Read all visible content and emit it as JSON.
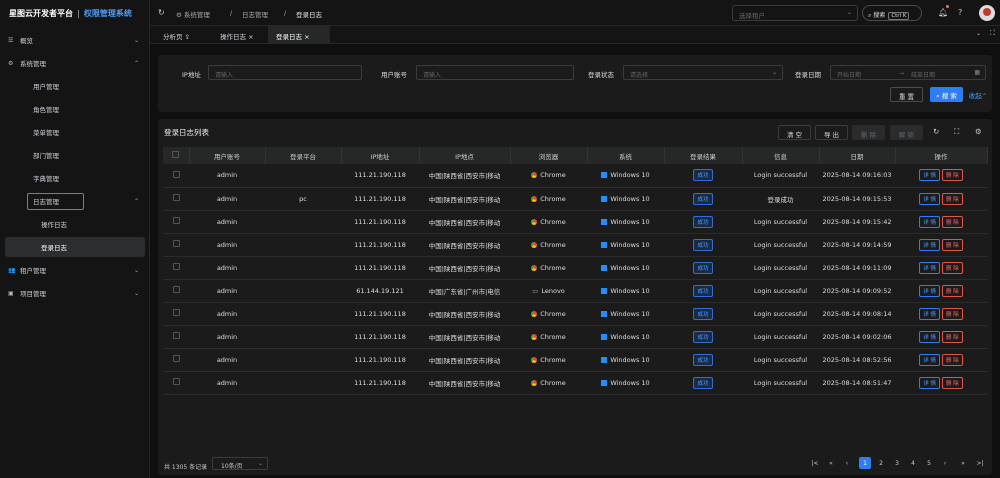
{
  "brand": {
    "name": "星图云开发者平台",
    "sep": "|",
    "sub": "权限管理系统"
  },
  "sidebar": {
    "overview": "概览",
    "system": "系统管理",
    "user": "用户管理",
    "role": "角色管理",
    "menu": "菜单管理",
    "dept": "部门管理",
    "dict": "字典管理",
    "log": "日志管理",
    "oplog": "操作日志",
    "loginlog": "登录日志",
    "tenant": "租户管理",
    "project": "项目管理"
  },
  "header": {
    "bc1": "系统管理",
    "bc2": "日志管理",
    "bc3": "登录日志",
    "tenant_placeholder": "选择租户",
    "search": "搜索",
    "kbd": "Ctrl K"
  },
  "tabs": [
    "分析页",
    "操作日志",
    "登录日志"
  ],
  "filter": {
    "ip_label": "IP地址",
    "ip_ph": "请输入",
    "user_label": "用户账号",
    "user_ph": "请输入",
    "status_label": "登录状态",
    "status_ph": "请选择",
    "date_label": "登录日期",
    "start_ph": "开始日期",
    "arrow": "→",
    "end_ph": "结束日期",
    "reset": "重 置",
    "search": "搜 索",
    "collapse": "收起"
  },
  "table": {
    "title": "登录日志列表",
    "buttons": {
      "clear": "清 空",
      "export": "导 出",
      "delete": "删 除",
      "unlock": "解 锁"
    },
    "columns": [
      "用户账号",
      "登录平台",
      "IP地址",
      "IP地点",
      "浏览器",
      "系统",
      "登录结果",
      "信息",
      "日期",
      "操作"
    ],
    "rows": [
      {
        "user": "admin",
        "platform": "",
        "ip": "111.21.190.118",
        "loc": "中国|陕西省|西安市|移动",
        "browser": "Chrome",
        "os": "Windows 10",
        "result": "成功",
        "msg": "Login successful",
        "date": "2025-08-14 09:16:03"
      },
      {
        "user": "admin",
        "platform": "pc",
        "ip": "111.21.190.118",
        "loc": "中国|陕西省|西安市|移动",
        "browser": "Chrome",
        "os": "Windows 10",
        "result": "成功",
        "msg": "登录成功",
        "date": "2025-08-14 09:15:53"
      },
      {
        "user": "admin",
        "platform": "",
        "ip": "111.21.190.118",
        "loc": "中国|陕西省|西安市|移动",
        "browser": "Chrome",
        "os": "Windows 10",
        "result": "成功",
        "msg": "Login successful",
        "date": "2025-08-14 09:15:42"
      },
      {
        "user": "admin",
        "platform": "",
        "ip": "111.21.190.118",
        "loc": "中国|陕西省|西安市|移动",
        "browser": "Chrome",
        "os": "Windows 10",
        "result": "成功",
        "msg": "Login successful",
        "date": "2025-08-14 09:14:59"
      },
      {
        "user": "admin",
        "platform": "",
        "ip": "111.21.190.118",
        "loc": "中国|陕西省|西安市|移动",
        "browser": "Chrome",
        "os": "Windows 10",
        "result": "成功",
        "msg": "Login successful",
        "date": "2025-08-14 09:11:09"
      },
      {
        "user": "admin",
        "platform": "",
        "ip": "61.144.19.121",
        "loc": "中国|广东省|广州市|电信",
        "browser": "Lenovo",
        "os": "Windows 10",
        "result": "成功",
        "msg": "Login successful",
        "date": "2025-08-14 09:09:52"
      },
      {
        "user": "admin",
        "platform": "",
        "ip": "111.21.190.118",
        "loc": "中国|陕西省|西安市|移动",
        "browser": "Chrome",
        "os": "Windows 10",
        "result": "成功",
        "msg": "Login successful",
        "date": "2025-08-14 09:08:14"
      },
      {
        "user": "admin",
        "platform": "",
        "ip": "111.21.190.118",
        "loc": "中国|陕西省|西安市|移动",
        "browser": "Chrome",
        "os": "Windows 10",
        "result": "成功",
        "msg": "Login successful",
        "date": "2025-08-14 09:02:06"
      },
      {
        "user": "admin",
        "platform": "",
        "ip": "111.21.190.118",
        "loc": "中国|陕西省|西安市|移动",
        "browser": "Chrome",
        "os": "Windows 10",
        "result": "成功",
        "msg": "Login successful",
        "date": "2025-08-14 08:52:56"
      },
      {
        "user": "admin",
        "platform": "",
        "ip": "111.21.190.118",
        "loc": "中国|陕西省|西安市|移动",
        "browser": "Chrome",
        "os": "Windows 10",
        "result": "成功",
        "msg": "Login successful",
        "date": "2025-08-14 08:51:47"
      }
    ],
    "actions": {
      "detail": "详 情",
      "delete": "删 除"
    }
  },
  "pager": {
    "total": "共 1305 条记录",
    "per_page": "10条/页",
    "pages": [
      "1",
      "2",
      "3",
      "4",
      "5"
    ]
  }
}
